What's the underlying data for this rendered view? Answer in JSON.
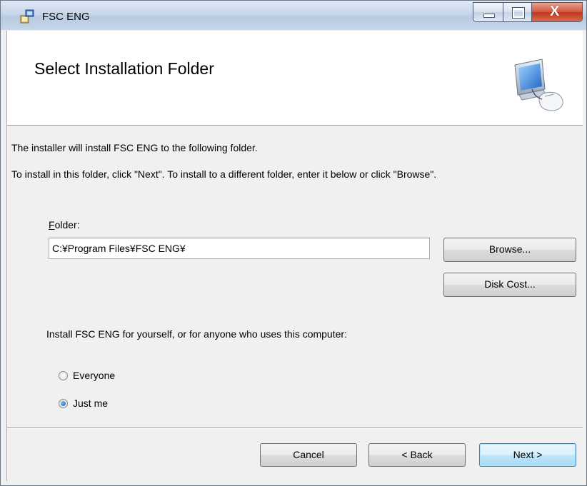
{
  "window": {
    "title": "FSC ENG",
    "title_icon": "installer-icon"
  },
  "caption_buttons": {
    "minimize": "minimize-icon",
    "maximize": "maximize-icon",
    "close_glyph": "X"
  },
  "banner": {
    "title": "Select Installation Folder",
    "icon": "computer-mouse-icon"
  },
  "body": {
    "line1": "The installer will install FSC ENG to the following folder.",
    "line2": "To install in this folder, click \"Next\". To install to a different folder, enter it below or click \"Browse\"."
  },
  "folder": {
    "label_accesskey": "F",
    "label_rest": "older:",
    "value": "C:¥Program Files¥FSC ENG¥"
  },
  "buttons": {
    "browse": "Browse...",
    "disk_cost": "Disk Cost...",
    "cancel": "Cancel",
    "back": "< Back",
    "next": "Next >"
  },
  "install_for": {
    "prompt": "Install FSC ENG for yourself, or for anyone who uses this computer:",
    "options": [
      {
        "label": "Everyone",
        "selected": false
      },
      {
        "label": "Just me",
        "selected": true
      }
    ]
  },
  "colors": {
    "titlebar": "#c7d6ea",
    "close_button": "#c0361f",
    "default_button_border": "#3c7fb1"
  }
}
